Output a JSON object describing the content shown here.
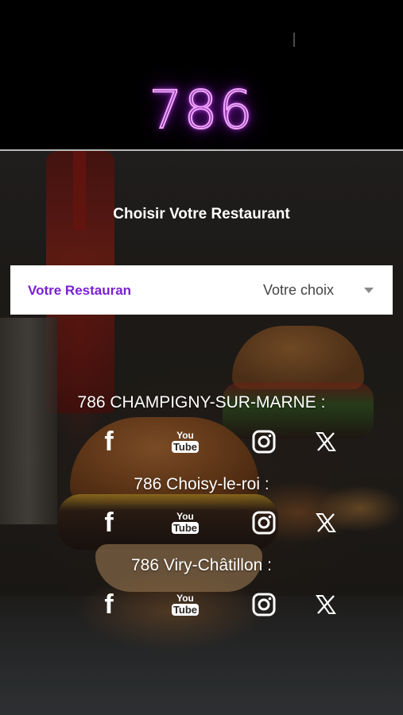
{
  "header": {
    "logo_text": "786",
    "logo_color": "#d35cff"
  },
  "picker": {
    "title": "Choisir Votre Restaurant",
    "label": "Votre Restauran",
    "value": "Votre choix",
    "label_color": "#7b1fd2"
  },
  "locations": [
    {
      "name": "786 CHAMPIGNY-SUR-MARNE :",
      "socials": [
        "facebook-icon",
        "youtube-icon",
        "instagram-icon",
        "x-icon"
      ]
    },
    {
      "name": "786 Choisy-le-roi :",
      "socials": [
        "facebook-icon",
        "youtube-icon",
        "instagram-icon",
        "x-icon"
      ]
    },
    {
      "name": "786 Viry-Châtillon :",
      "socials": [
        "facebook-icon",
        "youtube-icon",
        "instagram-icon",
        "x-icon"
      ]
    }
  ],
  "icons": {
    "facebook": "f",
    "youtube_top": "You",
    "youtube_bottom": "Tube"
  }
}
